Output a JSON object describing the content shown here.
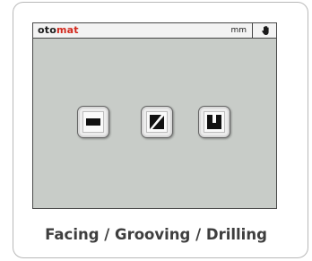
{
  "app": {
    "logo_part1": "oto",
    "logo_part2": "mat",
    "unit": "mm"
  },
  "colors": {
    "screen_background": "#c8ccc8",
    "logo_dark": "#1c1c1c",
    "logo_red": "#d2291d",
    "caption_text": "#3e3e3e"
  },
  "icons": {
    "hand": "hand-icon",
    "facing": "facing-icon",
    "grooving": "grooving-icon",
    "drilling": "drilling-icon"
  },
  "caption": "Facing / Grooving / Drilling"
}
